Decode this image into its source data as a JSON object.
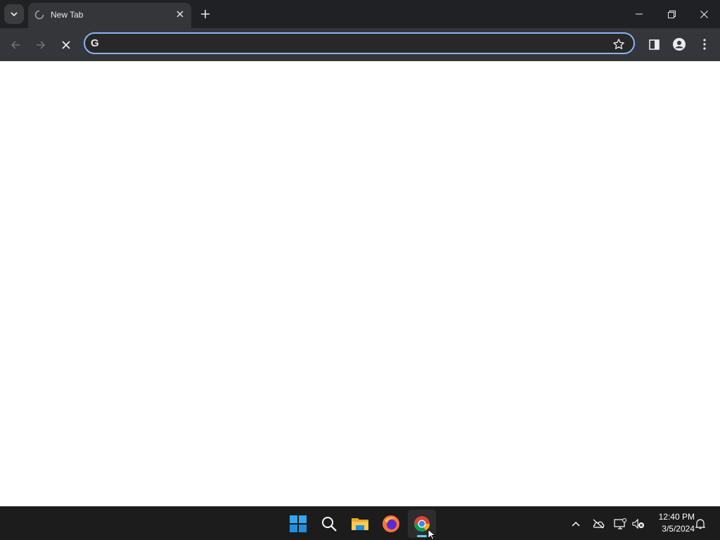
{
  "browser": {
    "tab": {
      "title": "New Tab"
    },
    "omnibox": {
      "value": "",
      "placeholder": "",
      "engine_glyph": "G"
    },
    "icons": {
      "tab_search": "chevron-down-icon",
      "tab_loading": "spinner-icon",
      "tab_close": "close-icon",
      "new_tab": "plus-icon",
      "minimize": "minimize-icon",
      "restore": "restore-icon",
      "close_window": "close-icon",
      "back": "back-arrow-icon",
      "forward": "forward-arrow-icon",
      "stop": "stop-icon",
      "bookmark": "star-icon",
      "side_panel": "side-panel-icon",
      "profile": "profile-icon",
      "menu": "kebab-menu-icon"
    }
  },
  "taskbar": {
    "apps": [
      "start-button",
      "search",
      "file-explorer",
      "firefox",
      "chrome"
    ],
    "active_app": "chrome",
    "clock": {
      "time": "12:40 PM",
      "date": "3/5/2024"
    },
    "tray_icons": [
      "chevron-up-icon",
      "onedrive-offline-icon",
      "network-icon",
      "volume-muted-icon",
      "notification-bell-icon"
    ]
  },
  "colors": {
    "tabstrip": "#202124",
    "toolbar": "#35363a",
    "omnibox_focus": "#8ab4f8",
    "taskbar": "#1c1c1c",
    "accent": "#60cdff"
  }
}
